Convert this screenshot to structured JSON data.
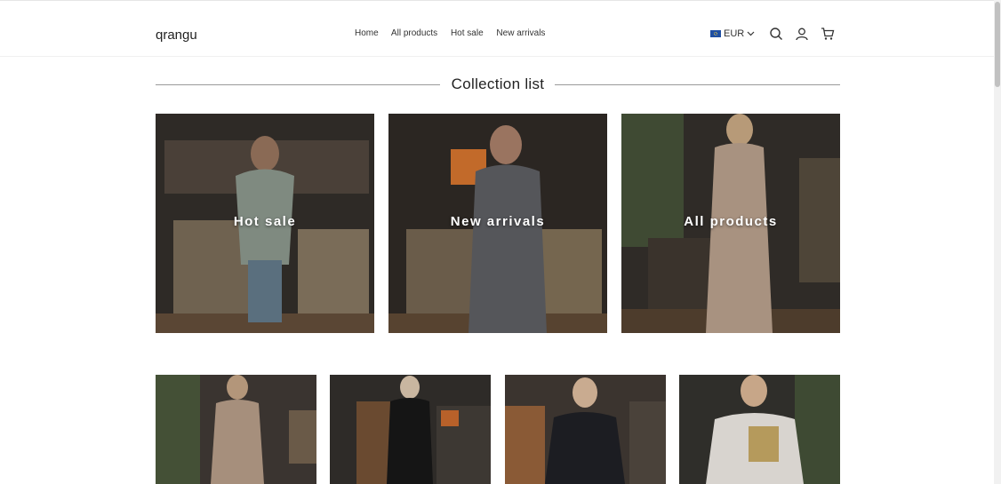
{
  "header": {
    "logo": "qrangu",
    "nav": [
      "Home",
      "All products",
      "Hot sale",
      "New arrivals"
    ],
    "currency": "EUR"
  },
  "icons": {
    "search": "search-icon",
    "account": "user-icon",
    "cart": "cart-icon",
    "currency_caret": "chevron-down-icon"
  },
  "section": {
    "title": "Collection list"
  },
  "collections": [
    {
      "label": "Hot sale"
    },
    {
      "label": "New arrivals"
    },
    {
      "label": "All products"
    }
  ],
  "colors": {
    "text": "#222222",
    "divider": "#9a9a9a",
    "overlay_text": "#ffffff"
  }
}
